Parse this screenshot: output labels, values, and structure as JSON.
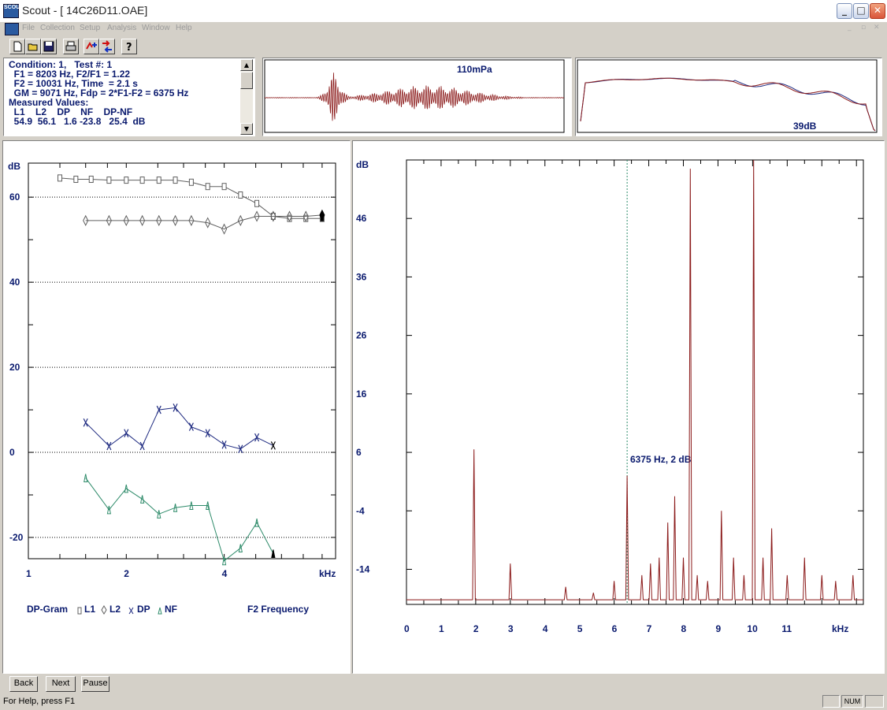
{
  "window": {
    "title": "Scout - [ 14C26D11.OAE]",
    "app_icon_text": "SCOUT",
    "buttons": {
      "minimize": "_",
      "maximize": "□",
      "close": "✕"
    }
  },
  "menu": {
    "items": [
      "File",
      "Collection",
      "Setup",
      "Analysis",
      "Window",
      "Help"
    ]
  },
  "toolbar": {
    "icons": [
      "new-file-icon",
      "open-folder-icon",
      "save-icon",
      "print-icon",
      "transfer-icon",
      "swap-icon",
      "help-icon"
    ]
  },
  "info": {
    "lines": [
      "Condition: 1,   Test #: 1",
      "  F1 = 8203 Hz, F2/F1 = 1.22",
      "  F2 = 10031 Hz, Time  = 2.1 s",
      "  GM = 9071 Hz, Fdp = 2*F1-F2 = 6375 Hz",
      "Measured Values:",
      "  L1    L2    DP    NF    DP-NF",
      "  54.9  56.1   1.6 -23.8   25.4  dB"
    ]
  },
  "waveform": {
    "label": "110mPa"
  },
  "spectrum_mini": {
    "label": "39dB"
  },
  "dpgram": {
    "ylabel": "dB",
    "xlabel": "kHz",
    "yticks": [
      "60",
      "40",
      "20",
      "0",
      "-20"
    ],
    "xticks": [
      "1",
      "2",
      "4"
    ],
    "legend": {
      "title": "DP-Gram",
      "entries": [
        "L1",
        "L2",
        "DP",
        "NF"
      ],
      "right": "F2 Frequency"
    },
    "chart_data": {
      "type": "line",
      "x_scale": "log",
      "xlim": [
        1,
        8.8
      ],
      "ylim": [
        -25,
        68
      ],
      "series": [
        {
          "name": "L1",
          "color": "#606060",
          "marker": "square",
          "x": [
            1.25,
            1.4,
            1.56,
            1.77,
            2,
            2.24,
            2.52,
            2.83,
            3.17,
            3.56,
            4,
            4.49,
            5.04,
            5.66,
            6.35,
            7.13,
            8
          ],
          "y": [
            64.5,
            64.2,
            64.2,
            64.0,
            64.0,
            64.0,
            64.0,
            64.0,
            63.5,
            62.5,
            62.5,
            60.5,
            58.5,
            55.5,
            55.0,
            55.0,
            55.0
          ]
        },
        {
          "name": "L2",
          "color": "#606060",
          "marker": "diamond",
          "x": [
            1.5,
            1.77,
            2,
            2.24,
            2.52,
            2.83,
            3.17,
            3.56,
            4,
            4.49,
            5.04,
            5.66,
            6.35,
            7.13,
            8
          ],
          "y": [
            54.5,
            54.5,
            54.5,
            54.5,
            54.5,
            54.5,
            54.5,
            54.0,
            52.5,
            54.5,
            55.5,
            55.5,
            55.5,
            55.5,
            55.8
          ]
        },
        {
          "name": "DP",
          "color": "#1e2a80",
          "marker": "x",
          "x": [
            1.5,
            1.77,
            2,
            2.24,
            2.52,
            2.83,
            3.17,
            3.56,
            4,
            4.49,
            5.04,
            5.66,
            6.35,
            7.13,
            8
          ],
          "y": [
            7.0,
            1.5,
            4.5,
            1.5,
            10.0,
            10.5,
            6.0,
            4.5,
            1.8,
            0.8,
            3.5,
            1.6
          ]
        },
        {
          "name": "NF",
          "color": "#2e8b6a",
          "marker": "triangle",
          "x": [
            1.5,
            1.77,
            2,
            2.24,
            2.52,
            2.83,
            3.17,
            3.56,
            4,
            4.49,
            5.04,
            5.66,
            6.35,
            7.13,
            8
          ],
          "y": [
            -6.0,
            -13.5,
            -8.5,
            -11.0,
            -14.5,
            -13.0,
            -12.5,
            -12.5,
            -25.5,
            -22.5,
            -16.5,
            -23.8
          ]
        }
      ]
    }
  },
  "spectrum": {
    "ylabel": "dB",
    "xlabel": "kHz",
    "yticks": [
      "46",
      "36",
      "26",
      "16",
      "6",
      "-4",
      "-14"
    ],
    "xticks": [
      "0",
      "1",
      "2",
      "3",
      "4",
      "5",
      "6",
      "7",
      "8",
      "9",
      "10",
      "11"
    ],
    "marker_label": "6375 Hz, 2 dB",
    "chart_data": {
      "type": "line",
      "xlim": [
        0,
        13.2
      ],
      "ylim": [
        -20,
        56
      ],
      "marker_x": 6.375,
      "peaks": [
        {
          "x": 1.95,
          "y": 6.5
        },
        {
          "x": 3.0,
          "y": -13
        },
        {
          "x": 4.6,
          "y": -17
        },
        {
          "x": 5.4,
          "y": -18
        },
        {
          "x": 6.0,
          "y": -16
        },
        {
          "x": 6.375,
          "y": 2.0
        },
        {
          "x": 6.8,
          "y": -15
        },
        {
          "x": 7.05,
          "y": -13
        },
        {
          "x": 7.3,
          "y": -12
        },
        {
          "x": 7.55,
          "y": -6
        },
        {
          "x": 7.75,
          "y": -1.5
        },
        {
          "x": 8.0,
          "y": -12
        },
        {
          "x": 8.2,
          "y": 54.5
        },
        {
          "x": 8.4,
          "y": -15
        },
        {
          "x": 8.7,
          "y": -16
        },
        {
          "x": 9.1,
          "y": -4
        },
        {
          "x": 9.45,
          "y": -12
        },
        {
          "x": 9.75,
          "y": -15
        },
        {
          "x": 10.03,
          "y": 56.0
        },
        {
          "x": 10.3,
          "y": -12
        },
        {
          "x": 10.55,
          "y": -7
        },
        {
          "x": 11.0,
          "y": -15
        },
        {
          "x": 11.5,
          "y": -12
        },
        {
          "x": 12.0,
          "y": -15
        },
        {
          "x": 12.4,
          "y": -16
        },
        {
          "x": 12.9,
          "y": -15
        }
      ]
    }
  },
  "bottom": {
    "back": "Back",
    "next": "Next",
    "pause": "Pause"
  },
  "status": {
    "text": "For Help, press F1",
    "num": "NUM"
  }
}
